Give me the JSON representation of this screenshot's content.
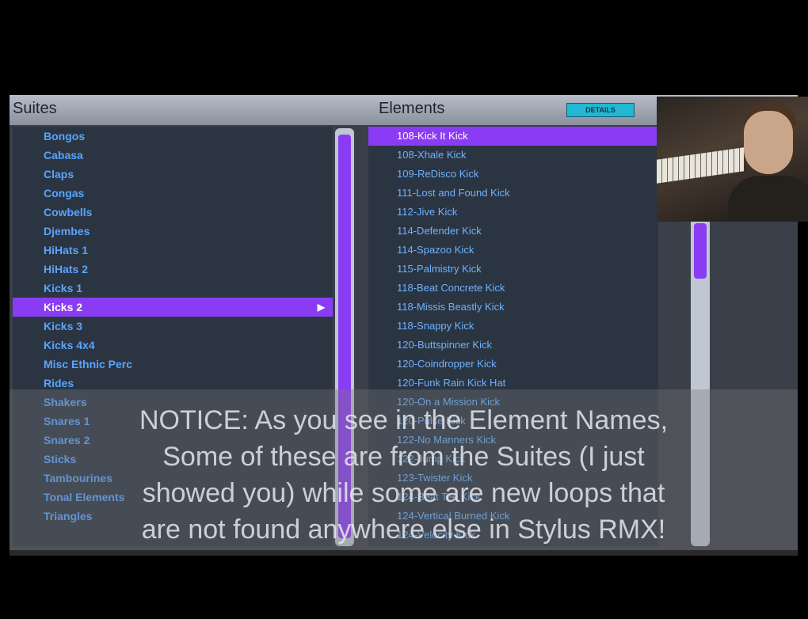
{
  "suites": {
    "title": "Suites",
    "items": [
      "Bongos",
      "Cabasa",
      "Claps",
      "Congas",
      "Cowbells",
      "Djembes",
      "HiHats 1",
      "HiHats 2",
      "Kicks 1",
      "Kicks 2",
      "Kicks 3",
      "Kicks 4x4",
      "Misc Ethnic Perc",
      "Rides",
      "Shakers",
      "Snares 1",
      "Snares 2",
      "Sticks",
      "Tambourines",
      "Tonal Elements",
      "Triangles"
    ],
    "selected_index": 9
  },
  "elements": {
    "title": "Elements",
    "badge": "DETAILS",
    "items": [
      "108-Kick It Kick",
      "108-Xhale Kick",
      "109-ReDisco Kick",
      "111-Lost and Found Kick",
      "112-Jive Kick",
      "114-Defender Kick",
      "114-Spazoo Kick",
      "115-Palmistry Kick",
      "118-Beat Concrete Kick",
      "118-Missis Beastly Kick",
      "118-Snappy Kick",
      "120-Buttspinner Kick",
      "120-Coindropper Kick",
      "120-Funk Rain Kick Hat",
      "120-On a Mission Kick",
      "120-Pulse Kick",
      "122-No Manners Kick",
      "122-Jump Kick",
      "123-Twister Kick",
      "124-Beat Tee Kick",
      "124-Vertical Burned Kick",
      "124-Velocity Kick"
    ],
    "selected_index": 0
  },
  "caption": {
    "lines": [
      "NOTICE: As you see in the Element Names,",
      "Some of these are from the Suites (I just",
      "showed you) while some are new loops that",
      "are not found anywhere else in Stylus RMX!"
    ]
  },
  "colors": {
    "accent": "#8a3cf4",
    "list_text": "#5aa4ff",
    "badge": "#22b7d2"
  }
}
